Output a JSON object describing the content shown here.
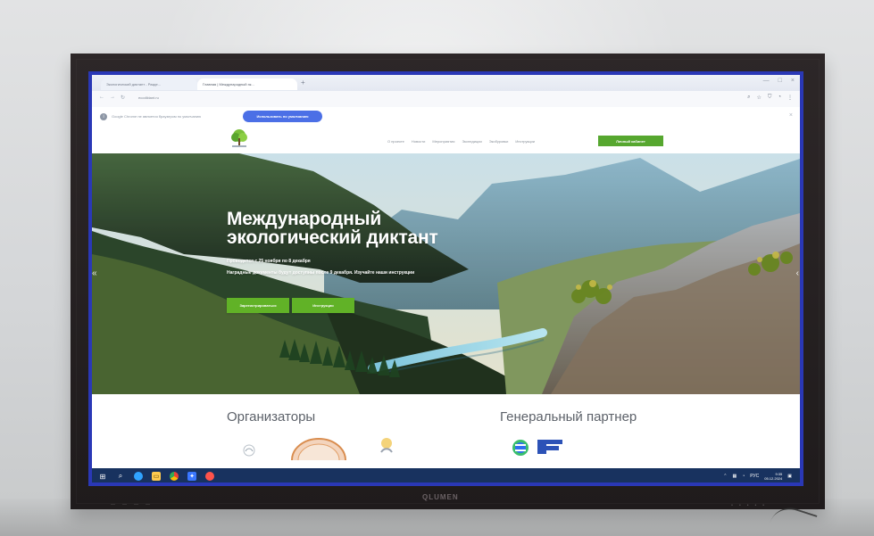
{
  "browser": {
    "tabs": [
      {
        "label": "Экологический диктант - Разде..."
      },
      {
        "label": "Главная | Международный эк..."
      }
    ],
    "address": "ecodiktant.ru",
    "notice": {
      "text": "Google Chrome не является браузером по умолчанию",
      "button_label": "Использовать по умолчанию"
    }
  },
  "site": {
    "nav": [
      "О проекте",
      "Новости",
      "Мероприятия",
      "Экспедиции",
      "Экобуровки",
      "Инструкции"
    ],
    "cabinet_label": "Личный кабинет",
    "hero": {
      "title_line1": "Международный",
      "title_line2": "экологический диктант",
      "subtitle_line1": "Проводится с 25 ноября по 8 декабря",
      "subtitle_line2": "Наградные документы будут доступны после 9 декабря. Изучайте наши инструкции",
      "register_label": "Зарегистрироваться",
      "instructions_label": "Инструкции"
    },
    "sections": {
      "organizers_title": "Организаторы",
      "partner_title": "Генеральный партнер"
    }
  },
  "taskbar": {
    "language": "РУС",
    "time": "9:35",
    "date": "05.12.2024"
  },
  "hardware": {
    "brand": "QLUMEN"
  },
  "colors": {
    "screen_border": "#2a38b6",
    "notice_button": "#4b6fe6",
    "site_green": "#56a72f",
    "taskbar": "#18325f"
  },
  "icons": {
    "start": "windows-start-icon",
    "search": "search-icon",
    "edge": "edge-icon",
    "folder": "folder-icon",
    "chrome": "chrome-icon",
    "app": "app-icon",
    "red_app": "red-app-icon"
  }
}
